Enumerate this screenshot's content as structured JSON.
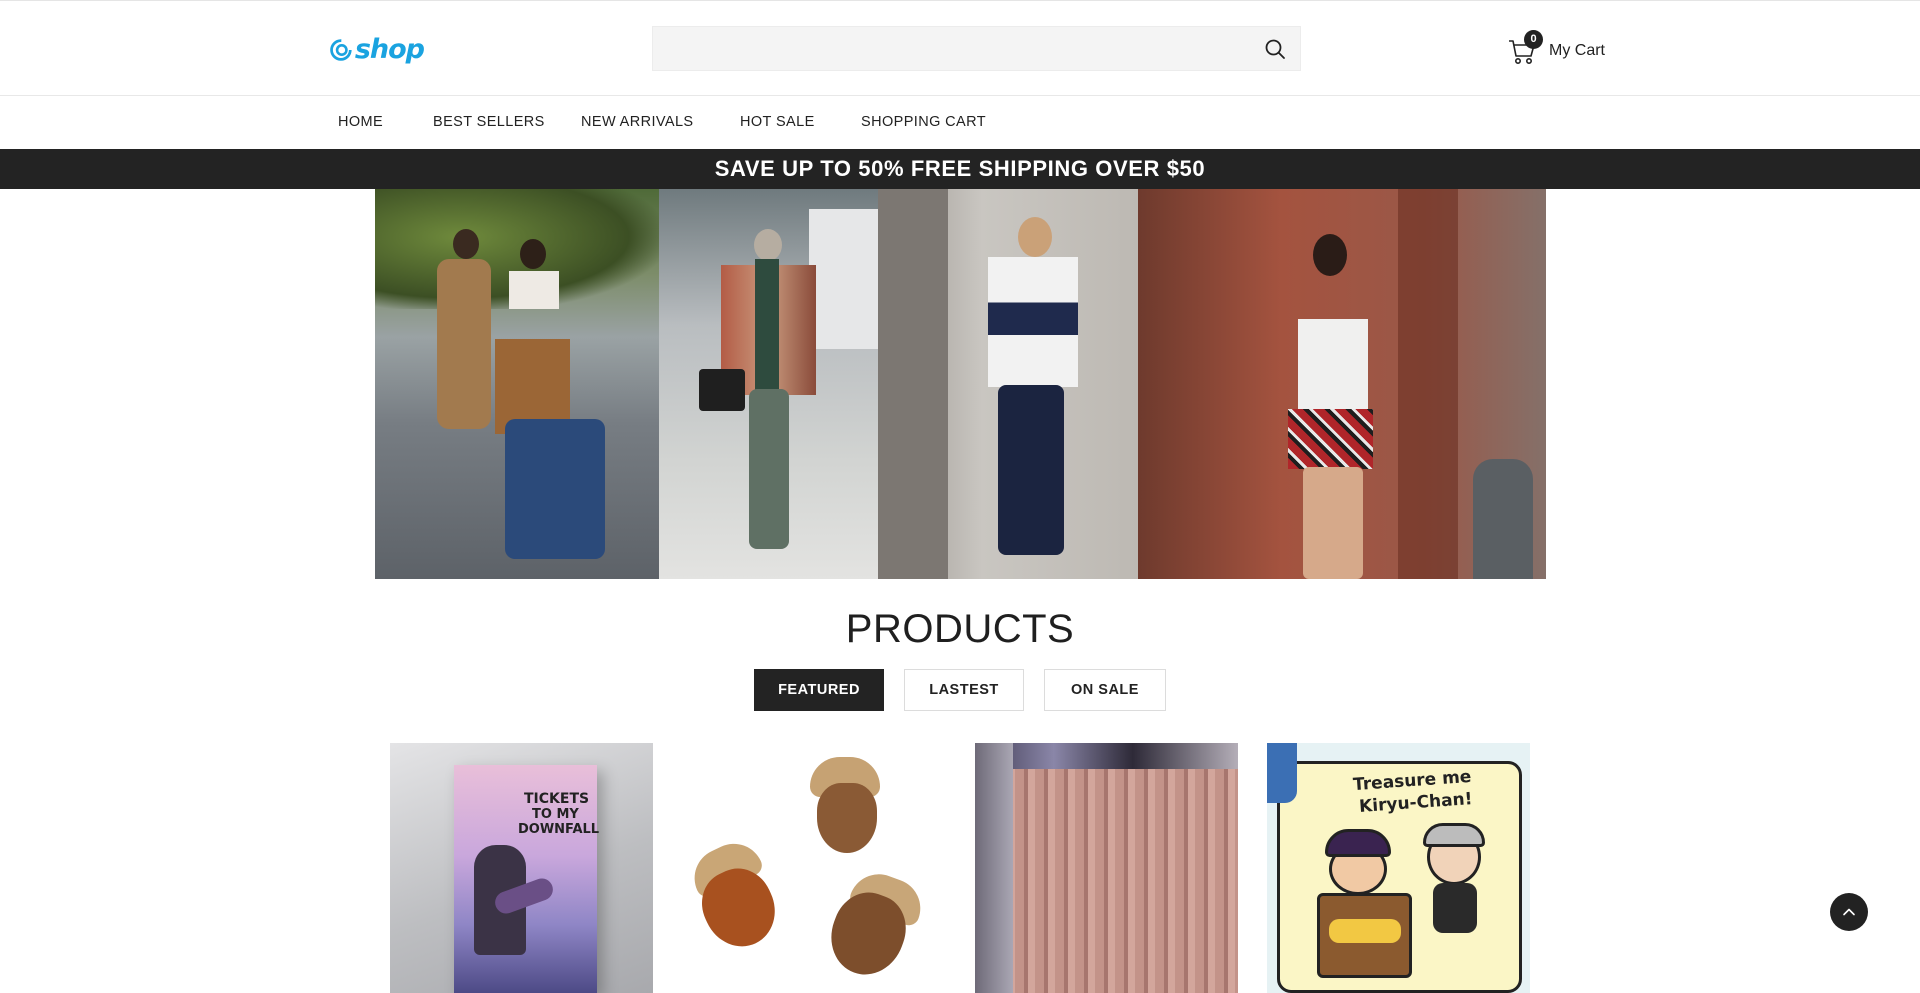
{
  "brand": {
    "logo_text": "shop",
    "accent": "#1aa3e0"
  },
  "search": {
    "placeholder": "",
    "value": "",
    "icon": "search-icon"
  },
  "cart": {
    "count": "0",
    "label": "My Cart",
    "icon": "cart-icon"
  },
  "nav": {
    "items": [
      {
        "label": "HOME"
      },
      {
        "label": "BEST SELLERS"
      },
      {
        "label": "NEW ARRIVALS"
      },
      {
        "label": "HOT SALE"
      },
      {
        "label": "SHOPPING CART"
      }
    ]
  },
  "promo": {
    "text": "SAVE UP TO 50% FREE SHIPPING OVER $50",
    "background": "#232323"
  },
  "hero": {
    "icon": "hero-banner-image"
  },
  "products": {
    "title": "PRODUCTS",
    "tabs": [
      {
        "label": "FEATURED",
        "active": true
      },
      {
        "label": "LASTEST",
        "active": false
      },
      {
        "label": "ON SALE",
        "active": false
      }
    ],
    "cards": [
      {
        "image": "poster-product-image",
        "poster_line1": "TICKETS",
        "poster_line2": "TO MY",
        "poster_line3": "DOWNFALL"
      },
      {
        "image": "acorn-product-image"
      },
      {
        "image": "curtain-product-image"
      },
      {
        "image": "sticker-product-image",
        "sticker_line1": "Treasure me",
        "sticker_line2": "Kiryu-Chan!"
      }
    ]
  },
  "back_to_top": {
    "icon": "chevron-up-icon"
  }
}
